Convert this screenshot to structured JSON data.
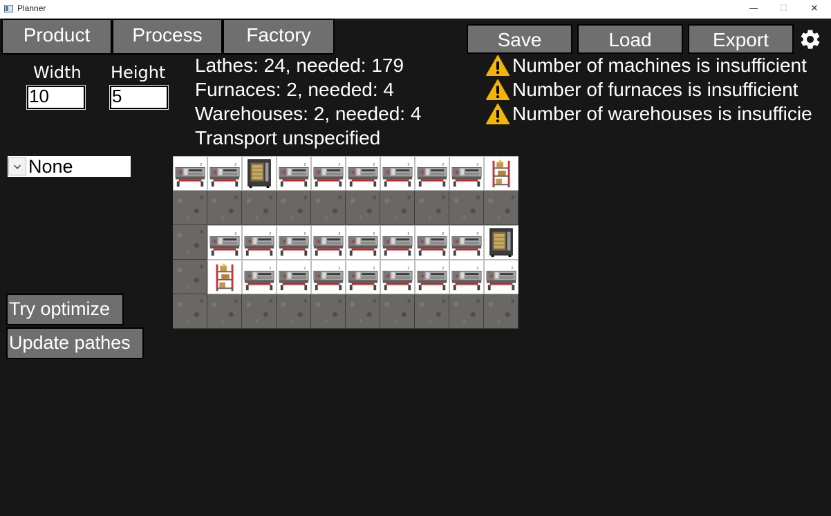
{
  "window": {
    "title": "Planner",
    "minimize": "—",
    "maximize": "☐",
    "close": "✕"
  },
  "tabs": [
    "Product",
    "Process",
    "Factory"
  ],
  "toolbar": {
    "save": "Save",
    "load": "Load",
    "export": "Export",
    "settings_icon": "gear-icon"
  },
  "dimensions": {
    "width_label": "Width",
    "width_value": "10",
    "height_label": "Height",
    "height_value": "5"
  },
  "stats": [
    "Lathes: 24, needed: 179",
    "Furnaces: 2, needed: 4",
    "Warehouses: 2, needed: 4",
    "Transport unspecified"
  ],
  "warnings": [
    "Number of machines is insufficient",
    "Number of furnaces is insufficient",
    "Number of warehouses is insufficie"
  ],
  "selector": {
    "value": "None"
  },
  "actions": {
    "optimize": "Try optimize",
    "update_paths": "Update pathes"
  },
  "colors": {
    "background": "#171717",
    "button": "#6f6f6f",
    "warning": "#f5b400",
    "floor": "#6a6864"
  },
  "grid": {
    "columns": 10,
    "rows": [
      [
        "lathe",
        "lathe",
        "furnace",
        "lathe",
        "lathe",
        "lathe",
        "lathe",
        "lathe",
        "lathe",
        "warehouse"
      ],
      [
        "floor",
        "floor",
        "floor",
        "floor",
        "floor",
        "floor",
        "floor",
        "floor",
        "floor",
        "floor"
      ],
      [
        "floor",
        "lathe",
        "lathe",
        "lathe",
        "lathe",
        "lathe",
        "lathe",
        "lathe",
        "lathe",
        "furnace"
      ],
      [
        "floor",
        "warehouse",
        "lathe",
        "lathe",
        "lathe",
        "lathe",
        "lathe",
        "lathe",
        "lathe",
        "lathe"
      ],
      [
        "floor",
        "floor",
        "floor",
        "floor",
        "floor",
        "floor",
        "floor",
        "floor",
        "floor",
        "floor"
      ]
    ]
  }
}
